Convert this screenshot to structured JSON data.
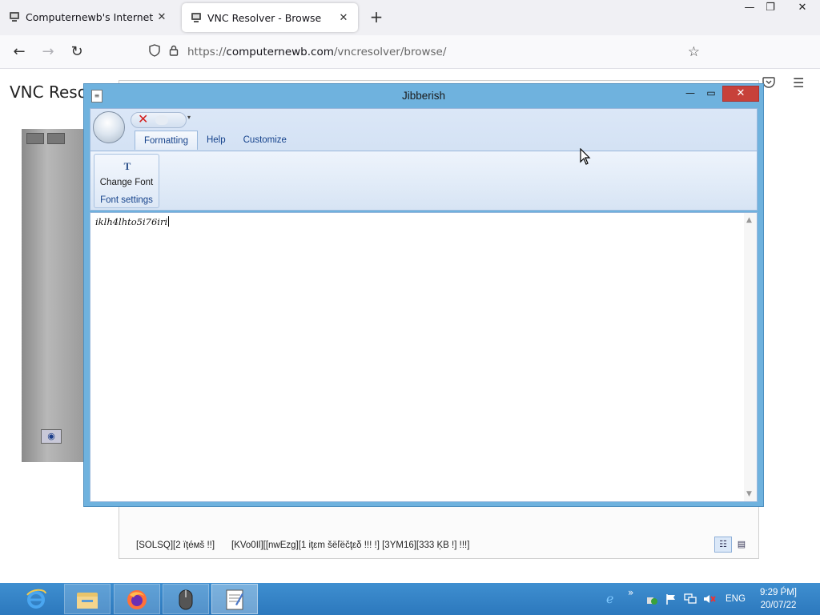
{
  "browser": {
    "tabs": [
      {
        "title": "Computernewb's Internet Pub",
        "close": "✕"
      },
      {
        "title": "VNC Resolver - Browse",
        "close": "✕"
      }
    ],
    "new_tab": "+",
    "window_controls": {
      "min": "—",
      "max": "❐",
      "close": "✕"
    },
    "nav": {
      "back": "←",
      "forward": "→",
      "reload": "↻"
    },
    "url": {
      "prefix": "https://",
      "host": "computernewb.com",
      "path": "/vncresolver/browse/"
    }
  },
  "page": {
    "title": "VNC Resol",
    "status_left": "[SOLSQ][2 ïţéмš !!]",
    "status_mid": "[KVo0Il][[nwEzg][1 iţεm šëľëčţεδ !!! !]  [3YM16][333 ĶB !] !!!]",
    "view_list": "☷",
    "view_icons": "▤"
  },
  "dialog": {
    "title": "Jibberish",
    "controls": {
      "min": "—",
      "max": "▭",
      "close": "✕"
    },
    "qat_close": "✕",
    "qat_dropdown": "▾",
    "ribbon_tabs": [
      {
        "label": "Formatting",
        "active": true
      },
      {
        "label": "Help",
        "active": false
      },
      {
        "label": "Customize",
        "active": false
      }
    ],
    "group": {
      "button_label": "Change Font",
      "group_label": "Font settings",
      "icon": "T"
    },
    "editor_text": "iklh4lhto5i76iri"
  },
  "taskbar": {
    "tray_more": "»",
    "language": "ENG",
    "time": "9:29 ṔM]",
    "date": "20/07/22"
  }
}
